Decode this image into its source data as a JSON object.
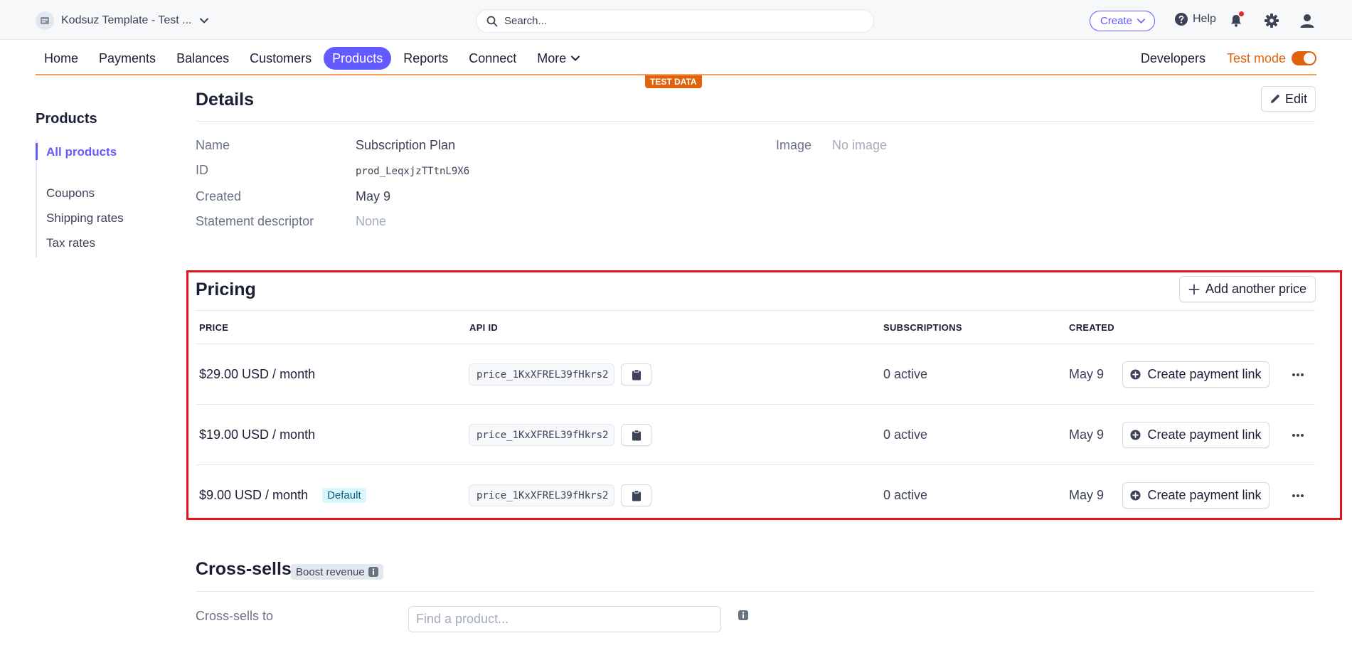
{
  "topbar": {
    "account_name": "Kodsuz Template - Test ...",
    "search_placeholder": "Search...",
    "create_label": "Create",
    "help_label": "Help"
  },
  "nav": {
    "items": [
      "Home",
      "Payments",
      "Balances",
      "Customers",
      "Products",
      "Reports",
      "Connect",
      "More"
    ],
    "active": "Products",
    "developers_label": "Developers",
    "test_mode_label": "Test mode",
    "test_mode_on": true,
    "test_data_badge": "TEST DATA"
  },
  "sidebar": {
    "title": "Products",
    "items": [
      "All products",
      "Coupons",
      "Shipping rates",
      "Tax rates"
    ],
    "active": "All products"
  },
  "details": {
    "title": "Details",
    "edit_label": "Edit",
    "fields": [
      {
        "label": "Name",
        "value": "Subscription Plan"
      },
      {
        "label": "ID",
        "value": "prod_LeqxjzTTtnL9X6"
      },
      {
        "label": "Created",
        "value": "May 9"
      },
      {
        "label": "Statement descriptor",
        "value": "None"
      }
    ],
    "image_label": "Image",
    "image_value": "No image"
  },
  "pricing": {
    "title": "Pricing",
    "add_price_label": "Add another price",
    "columns": [
      "PRICE",
      "API ID",
      "SUBSCRIPTIONS",
      "CREATED"
    ],
    "rows": [
      {
        "price": "$29.00 USD / month",
        "api_id": "price_1KxXFREL39fHkrs2",
        "subscriptions": "0 active",
        "created": "May 9",
        "payment_link_label": "Create payment link"
      },
      {
        "price": "$19.00 USD / month",
        "api_id": "price_1KxXFREL39fHkrs2",
        "subscriptions": "0 active",
        "created": "May 9",
        "payment_link_label": "Create payment link"
      },
      {
        "price": "$9.00 USD / month",
        "badge": "Default",
        "api_id": "price_1KxXFREL39fHkrs2",
        "subscriptions": "0 active",
        "created": "May 9",
        "payment_link_label": "Create payment link"
      }
    ]
  },
  "cross_sells": {
    "title": "Cross-sells",
    "badge": "Boost revenue",
    "label": "Cross-sells to",
    "input_placeholder": "Find a product..."
  },
  "colors": {
    "accent": "#635bff",
    "test_mode": "#e0620d",
    "highlight": "#e5141c"
  }
}
